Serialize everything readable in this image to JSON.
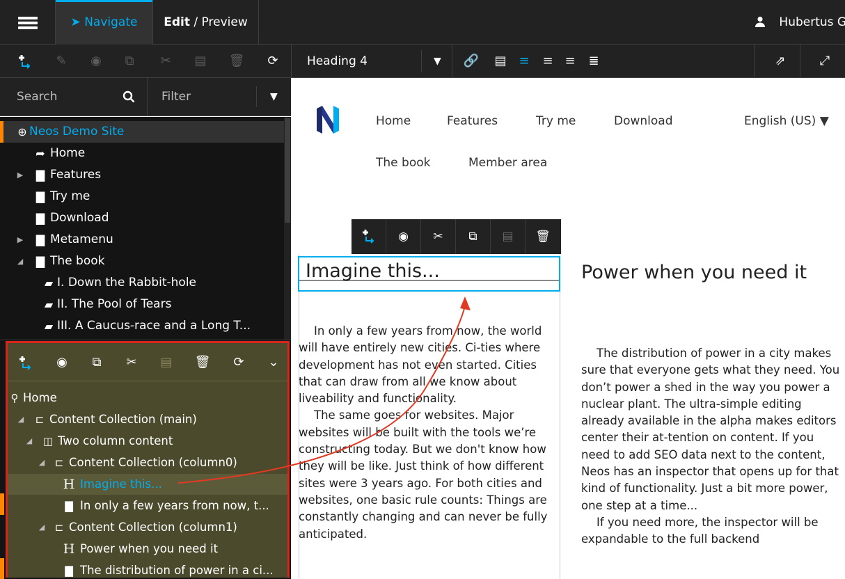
{
  "header": {
    "nav_tab": "Navigate",
    "edit_tab_bold": "Edit",
    "edit_tab_rest": " / Preview",
    "user_name": "Hubertus G"
  },
  "toolbar": {
    "style_select": "Heading 4"
  },
  "search": {
    "placeholder": "Search",
    "filter_placeholder": "Filter"
  },
  "page_tree": {
    "items": [
      {
        "label": "Neos Demo Site",
        "icon": "globe-icon"
      },
      {
        "label": "Home",
        "icon": "share-icon"
      },
      {
        "label": "Features",
        "icon": "file-icon"
      },
      {
        "label": "Try me",
        "icon": "file-icon"
      },
      {
        "label": "Download",
        "icon": "file-icon"
      },
      {
        "label": "Metamenu",
        "icon": "file-icon"
      },
      {
        "label": "The book",
        "icon": "file-icon"
      },
      {
        "label": "I. Down the Rabbit-hole",
        "icon": "book-icon"
      },
      {
        "label": "II. The Pool of Tears",
        "icon": "book-icon"
      },
      {
        "label": "III. A Caucus-race and a Long T...",
        "icon": "book-icon"
      }
    ]
  },
  "content_tree": {
    "items": [
      {
        "label": "Home",
        "icon": "sitemap-icon"
      },
      {
        "label": "Content Collection (main)",
        "icon": "folder-icon"
      },
      {
        "label": "Two column content",
        "icon": "columns-icon"
      },
      {
        "label": "Content Collection (column0)",
        "icon": "folder-icon"
      },
      {
        "label": "Imagine this...",
        "icon": "heading-icon"
      },
      {
        "label": "In only a few years from now, t...",
        "icon": "text-icon"
      },
      {
        "label": "Content Collection (column1)",
        "icon": "folder-icon"
      },
      {
        "label": "Power when you need it",
        "icon": "heading-icon"
      },
      {
        "label": "The distribution of power in a ci...",
        "icon": "text-icon"
      }
    ]
  },
  "site": {
    "menu": [
      "Home",
      "Features",
      "Try me",
      "Download",
      "The book",
      "Member area"
    ],
    "language": "English (US) ▼"
  },
  "content": {
    "heading1": "Imagine this...",
    "heading2": "Power when you need it",
    "col0_p1": "In only a few years from now, the world will have entirely new cities. Ci-ties where development has not even started. Cities that can draw from all we know about liveability and functionality.",
    "col0_p2": "The same goes for websites. Major websites will be built with the tools we’re constructing today. But we don't know how they will be like. Just think of how different sites were 3 years ago. For both cities and websites, one basic rule counts: Things are constantly changing and can never be fully anticipated.",
    "col1_p1": "The distribution of power in a city makes sure that everyone gets what they need. You don’t power a shed in the way you power a nuclear plant. The ultra-simple editing already available in the alpha makes editors center their at-tention on content. If you need to add SEO data next to the content, Neos has an inspector that opens up for that kind of functionality. Just a bit more power, one step at a time...",
    "col1_p2": "If you need more, the inspector will be expandable to the full backend"
  },
  "colors": {
    "accent_blue": "#00adee",
    "accent_orange": "#ff8700",
    "annotation_red": "#d8251c",
    "highlight_olive": "#4b4a2c"
  }
}
